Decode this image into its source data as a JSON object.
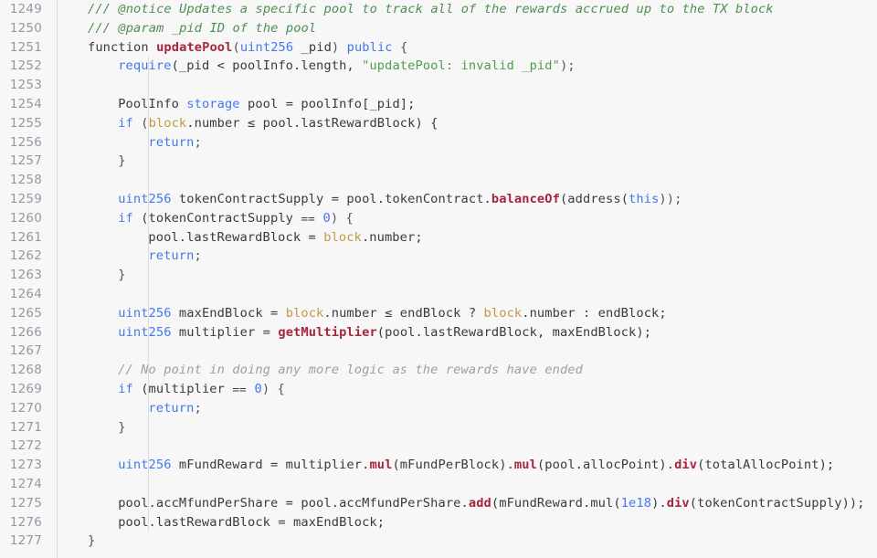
{
  "editor": {
    "language": "solidity",
    "background_color": "#f7f7f7",
    "gutter_color": "#9099a4",
    "first_line_number": 1249,
    "last_line_number": 1277,
    "colors": {
      "keyword": "#4078f2",
      "function": "#a6253e",
      "string": "#4f9e4c",
      "doc_comment": "#4f8f52",
      "comment": "#9aa0a6",
      "number": "#4078f2",
      "global": "#c09a43",
      "plain": "#383a42"
    }
  },
  "lines": [
    {
      "n": "1249",
      "indent": 0,
      "guide": false,
      "tokens": [
        {
          "t": "/// @notice Updates a specific pool to track all of the rewards accrued up to the TX block",
          "c": "doc"
        }
      ]
    },
    {
      "n": "1250",
      "indent": 0,
      "guide": false,
      "tokens": [
        {
          "t": "/// @param _pid ID of the pool",
          "c": "doc"
        }
      ]
    },
    {
      "n": "1251",
      "indent": 0,
      "guide": false,
      "tokens": [
        {
          "t": "function ",
          "c": "pl"
        },
        {
          "t": "updatePool",
          "c": "fn"
        },
        {
          "t": "(",
          "c": "pun"
        },
        {
          "t": "uint256",
          "c": "k"
        },
        {
          "t": " _pid",
          "c": "pl"
        },
        {
          "t": ") ",
          "c": "pun"
        },
        {
          "t": "public",
          "c": "k"
        },
        {
          "t": " {",
          "c": "pun"
        }
      ]
    },
    {
      "n": "1252",
      "indent": 1,
      "guide": true,
      "tokens": [
        {
          "t": "require",
          "c": "k"
        },
        {
          "t": "(_pid < poolInfo.length, ",
          "c": "pl"
        },
        {
          "t": "\"updatePool: invalid _pid\"",
          "c": "str"
        },
        {
          "t": ");",
          "c": "pun"
        }
      ]
    },
    {
      "n": "1253",
      "indent": 1,
      "guide": true,
      "tokens": []
    },
    {
      "n": "1254",
      "indent": 1,
      "guide": true,
      "tokens": [
        {
          "t": "PoolInfo ",
          "c": "pl"
        },
        {
          "t": "storage",
          "c": "k"
        },
        {
          "t": " pool = poolInfo[_pid];",
          "c": "pl"
        }
      ]
    },
    {
      "n": "1255",
      "indent": 1,
      "guide": true,
      "tokens": [
        {
          "t": "if",
          "c": "k"
        },
        {
          "t": " (",
          "c": "pun"
        },
        {
          "t": "block",
          "c": "glb"
        },
        {
          "t": ".number ≤ pool.lastRewardBlock) {",
          "c": "pl"
        }
      ]
    },
    {
      "n": "1256",
      "indent": 2,
      "guide": true,
      "tokens": [
        {
          "t": "return",
          "c": "k"
        },
        {
          "t": ";",
          "c": "pun"
        }
      ]
    },
    {
      "n": "1257",
      "indent": 1,
      "guide": true,
      "tokens": [
        {
          "t": "}",
          "c": "pun"
        }
      ]
    },
    {
      "n": "1258",
      "indent": 1,
      "guide": true,
      "tokens": []
    },
    {
      "n": "1259",
      "indent": 1,
      "guide": true,
      "tokens": [
        {
          "t": "uint256",
          "c": "k"
        },
        {
          "t": " tokenContractSupply = pool.tokenContract.",
          "c": "pl"
        },
        {
          "t": "balanceOf",
          "c": "fn"
        },
        {
          "t": "(address(",
          "c": "pl"
        },
        {
          "t": "this",
          "c": "k"
        },
        {
          "t": "));",
          "c": "pun"
        }
      ]
    },
    {
      "n": "1260",
      "indent": 1,
      "guide": true,
      "tokens": [
        {
          "t": "if",
          "c": "k"
        },
        {
          "t": " (tokenContractSupply ⩵ ",
          "c": "pl"
        },
        {
          "t": "0",
          "c": "num"
        },
        {
          "t": ") {",
          "c": "pun"
        }
      ]
    },
    {
      "n": "1261",
      "indent": 2,
      "guide": true,
      "tokens": [
        {
          "t": "pool.lastRewardBlock = ",
          "c": "pl"
        },
        {
          "t": "block",
          "c": "glb"
        },
        {
          "t": ".number;",
          "c": "pl"
        }
      ]
    },
    {
      "n": "1262",
      "indent": 2,
      "guide": true,
      "tokens": [
        {
          "t": "return",
          "c": "k"
        },
        {
          "t": ";",
          "c": "pun"
        }
      ]
    },
    {
      "n": "1263",
      "indent": 1,
      "guide": true,
      "tokens": [
        {
          "t": "}",
          "c": "pun"
        }
      ]
    },
    {
      "n": "1264",
      "indent": 1,
      "guide": true,
      "tokens": []
    },
    {
      "n": "1265",
      "indent": 1,
      "guide": true,
      "tokens": [
        {
          "t": "uint256",
          "c": "k"
        },
        {
          "t": " maxEndBlock = ",
          "c": "pl"
        },
        {
          "t": "block",
          "c": "glb"
        },
        {
          "t": ".number ≤ endBlock ? ",
          "c": "pl"
        },
        {
          "t": "block",
          "c": "glb"
        },
        {
          "t": ".number : endBlock;",
          "c": "pl"
        }
      ]
    },
    {
      "n": "1266",
      "indent": 1,
      "guide": true,
      "tokens": [
        {
          "t": "uint256",
          "c": "k"
        },
        {
          "t": " multiplier = ",
          "c": "pl"
        },
        {
          "t": "getMultiplier",
          "c": "fn"
        },
        {
          "t": "(pool.lastRewardBlock, maxEndBlock);",
          "c": "pl"
        }
      ]
    },
    {
      "n": "1267",
      "indent": 1,
      "guide": true,
      "tokens": []
    },
    {
      "n": "1268",
      "indent": 1,
      "guide": true,
      "tokens": [
        {
          "t": "// No point in doing any more logic as the rewards have ended",
          "c": "cmt"
        }
      ]
    },
    {
      "n": "1269",
      "indent": 1,
      "guide": true,
      "tokens": [
        {
          "t": "if",
          "c": "k"
        },
        {
          "t": " (multiplier ⩵ ",
          "c": "pl"
        },
        {
          "t": "0",
          "c": "num"
        },
        {
          "t": ") {",
          "c": "pun"
        }
      ]
    },
    {
      "n": "1270",
      "indent": 2,
      "guide": true,
      "tokens": [
        {
          "t": "return",
          "c": "k"
        },
        {
          "t": ";",
          "c": "pun"
        }
      ]
    },
    {
      "n": "1271",
      "indent": 1,
      "guide": true,
      "tokens": [
        {
          "t": "}",
          "c": "pun"
        }
      ]
    },
    {
      "n": "1272",
      "indent": 1,
      "guide": true,
      "tokens": []
    },
    {
      "n": "1273",
      "indent": 1,
      "guide": true,
      "tokens": [
        {
          "t": "uint256",
          "c": "k"
        },
        {
          "t": " mFundReward = multiplier.",
          "c": "pl"
        },
        {
          "t": "mul",
          "c": "fn"
        },
        {
          "t": "(mFundPerBlock).",
          "c": "pl"
        },
        {
          "t": "mul",
          "c": "fn"
        },
        {
          "t": "(pool.allocPoint).",
          "c": "pl"
        },
        {
          "t": "div",
          "c": "fn"
        },
        {
          "t": "(totalAllocPoint);",
          "c": "pl"
        }
      ]
    },
    {
      "n": "1274",
      "indent": 1,
      "guide": true,
      "tokens": []
    },
    {
      "n": "1275",
      "indent": 1,
      "guide": true,
      "tokens": [
        {
          "t": "pool.accMfundPerShare = pool.accMfundPerShare.",
          "c": "pl"
        },
        {
          "t": "add",
          "c": "fn"
        },
        {
          "t": "(mFundReward.mul(",
          "c": "pl"
        },
        {
          "t": "1e18",
          "c": "num"
        },
        {
          "t": ").",
          "c": "pl"
        },
        {
          "t": "div",
          "c": "fn"
        },
        {
          "t": "(tokenContractSupply));",
          "c": "pl"
        }
      ]
    },
    {
      "n": "1276",
      "indent": 1,
      "guide": true,
      "tokens": [
        {
          "t": "pool.lastRewardBlock = maxEndBlock;",
          "c": "pl"
        }
      ]
    },
    {
      "n": "1277",
      "indent": 0,
      "guide": false,
      "tokens": [
        {
          "t": "}",
          "c": "pun"
        }
      ]
    }
  ]
}
